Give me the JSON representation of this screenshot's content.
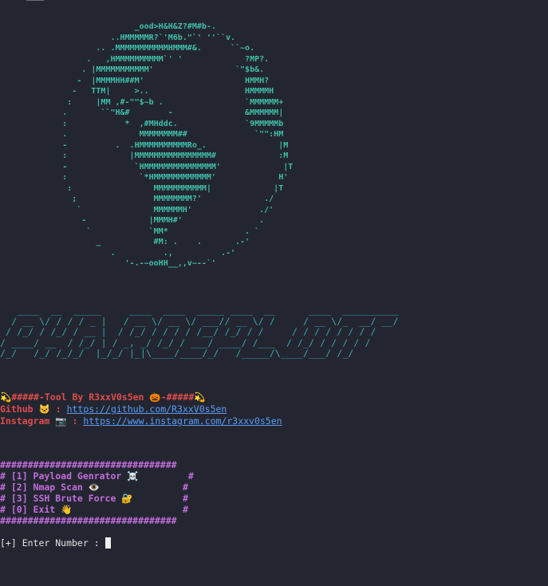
{
  "ascii_art": {
    "lines": [
      "                            _ood>H&H&Z?#M#b-.",
      "                       ..HMMMMMR?`'M6b.\"`' ''``v.",
      "                    .. .MMMMMMMMMMMHMMM#&.      ``~o.",
      "                  .   ,HMMMMMMMMMM`' '             ?MP?.",
      "                 . |MMMMMMMMMMM'                 `\"$b&.",
      "                -  |MMMMHH##M'                     HMMH?",
      "               -   TTM|     >..                    HMMMMH",
      "              :     |MM ,#-\"\"$~b .                 `MMMMMM+",
      "             .       ``\"H&#        -               &MMMMMM|",
      "             :            *  ,#MHddc.              `9MMMMMb",
      "             .               MMMMMMMM##              `\"\":HM",
      "             -          .  .HMMMMMMMMMMRo_.               |M",
      "             :             |MMMMMMMMMMMMMMMM#             :M",
      "             -              `HMMMMMMMMMMMMMMM'             |T",
      "             :               `*HMMMMMMMMMMMM'             H'",
      "              :                 MMMMMMMMMMM|             |T",
      "               ;                MMMMMMMM?'             ./",
      "                `               MMMMMMH'              ./'",
      "                 -             |MMMH#'                .",
      "                  `            `MM*                . `",
      "                    _           #M: .    .       .-'",
      "                       .          .,          .-'",
      "                          '-.-~ooHH__,,v~--`'"
    ]
  },
  "banner": {
    "lines": [
      "   ____  __  _____     ____  ____  _____ ____  __      ____  __________",
      "  / __ \\/ / / / _ |   / __ \\/ __ \\/ ___// __ \\/ /     / __ \\/_  __/ __/",
      " / /_/ / /_/ / __ |  / /_/ / / / / /__/ /_/ / /     / / / / / / / /",
      "/ ____/ __  / /_/ | / _, _/ /_/ / ___/ ____/ /___  / /_/ / / / / /",
      "/_/   /_/ /_/_/  |_/_/ |_|\\____/____/_/   /_____/\\____/___/ /_/"
    ]
  },
  "info": {
    "tool_by": "💫#####-Tool By R3xxV0s5en 🎃-#####💫",
    "github_label": "Github 🐱 : ",
    "github_url": "https://github.com/R3xxV0s5en",
    "instagram_label": "Instagram 📷 : ",
    "instagram_url": "https://www.instagram.com/r3xxv0s5en"
  },
  "menu": {
    "border": "################################",
    "items": [
      "# [1] Payload Genrator ☠️         #",
      "# [2] Nmap Scan 👁️               #",
      "# [3] SSH Brute Force 🔐         #",
      "# [0] Exit 👋                    #"
    ]
  },
  "prompt": {
    "text": "[+] Enter Number : "
  },
  "colors": {
    "background": "#232631",
    "art_text": "#e8e8e8",
    "art_accent": "#3fbfa8",
    "banner": "#3aa3ad",
    "info_red": "#e04c4c",
    "link": "#5b9cf5",
    "menu": "#c36ddd",
    "prompt": "#e2e2e2"
  }
}
